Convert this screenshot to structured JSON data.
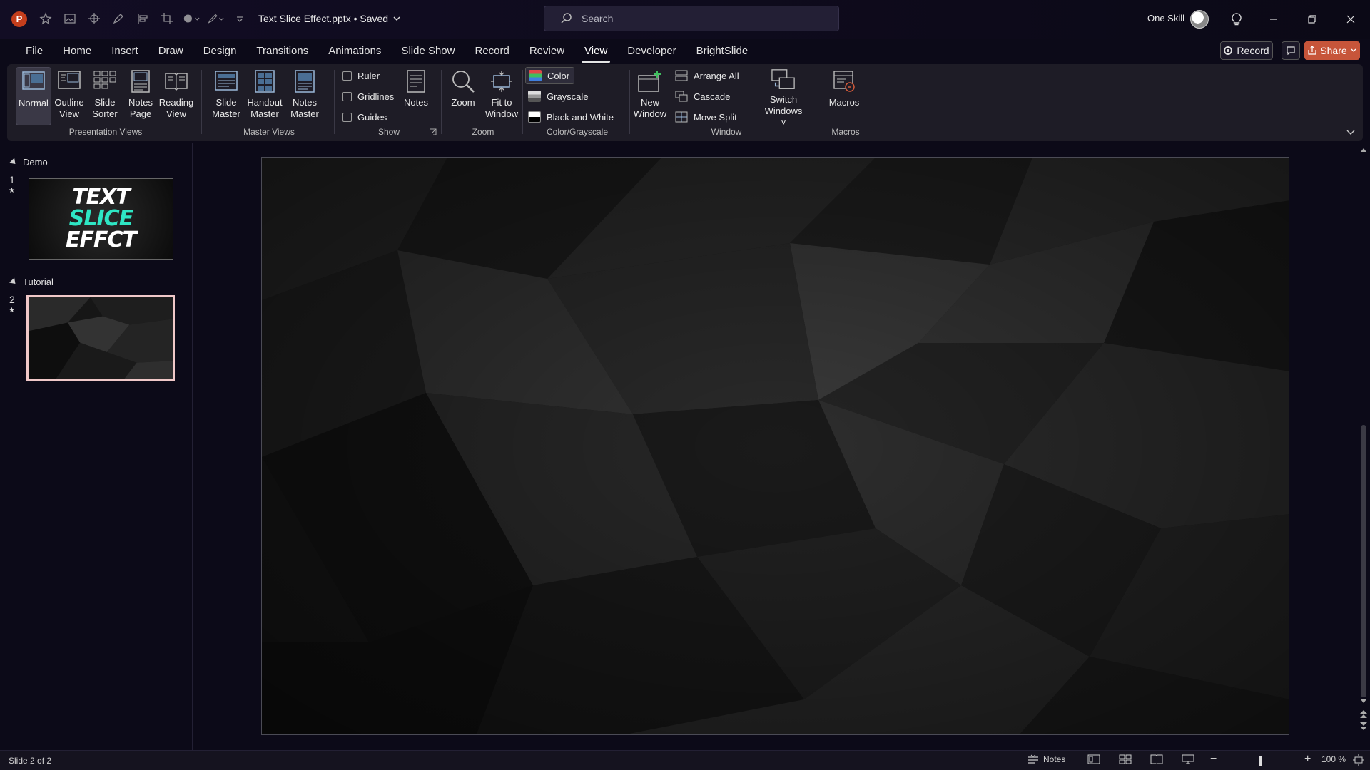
{
  "titlebar": {
    "app_icon": "P",
    "doc_title": "Text Slice Effect.pptx • Saved",
    "search_placeholder": "Search",
    "user_name": "One Skill"
  },
  "tabs": [
    "File",
    "Home",
    "Insert",
    "Draw",
    "Design",
    "Transitions",
    "Animations",
    "Slide Show",
    "Record",
    "Review",
    "View",
    "Developer",
    "BrightSlide"
  ],
  "active_tab": "View",
  "top_right": {
    "record_label": "Record",
    "share_label": "Share"
  },
  "ribbon": {
    "presentation_views": {
      "label": "Presentation Views",
      "normal": "Normal",
      "outline": [
        "Outline",
        "View"
      ],
      "sorter": [
        "Slide",
        "Sorter"
      ],
      "notes_page": [
        "Notes",
        "Page"
      ],
      "reading": [
        "Reading",
        "View"
      ]
    },
    "master_views": {
      "label": "Master Views",
      "slide_master": [
        "Slide",
        "Master"
      ],
      "handout_master": [
        "Handout",
        "Master"
      ],
      "notes_master": [
        "Notes",
        "Master"
      ]
    },
    "show": {
      "label": "Show",
      "ruler": "Ruler",
      "gridlines": "Gridlines",
      "guides": "Guides",
      "notes": "Notes"
    },
    "zoom": {
      "label": "Zoom",
      "zoom": "Zoom",
      "fit": [
        "Fit to",
        "Window"
      ]
    },
    "color": {
      "label": "Color/Grayscale",
      "color": "Color",
      "grayscale": "Grayscale",
      "bw": "Black and White"
    },
    "window": {
      "label": "Window",
      "new_window": [
        "New",
        "Window"
      ],
      "arrange_all": "Arrange All",
      "cascade": "Cascade",
      "move_split": "Move Split",
      "switch": [
        "Switch",
        "Windows"
      ]
    },
    "macros": {
      "label": "Macros",
      "macros": "Macros"
    }
  },
  "slide_pane": {
    "sections": [
      {
        "name": "Demo",
        "slide_number": "1"
      },
      {
        "name": "Tutorial",
        "slide_number": "2"
      }
    ],
    "thumb1_lines": [
      "TEXT",
      "SLICE",
      "EFFCT"
    ]
  },
  "status": {
    "slide_info": "Slide 2 of 2",
    "notes_label": "Notes",
    "zoom_level": "100 %"
  },
  "colors": {
    "accent": "#c43e1c",
    "slice_teal": "#2ee6c4",
    "share": "#c7553a"
  }
}
